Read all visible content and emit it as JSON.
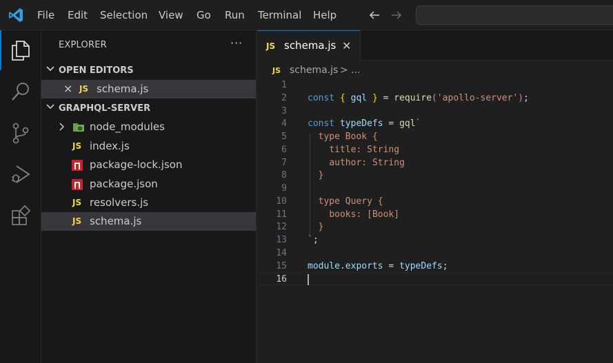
{
  "menu": {
    "items": [
      "File",
      "Edit",
      "Selection",
      "View",
      "Go",
      "Run",
      "Terminal",
      "Help"
    ],
    "back_icon": "arrow-left-icon",
    "forward_icon": "arrow-right-icon"
  },
  "activity_bar": {
    "items": [
      "explorer-icon",
      "search-icon",
      "source-control-icon",
      "run-debug-icon",
      "extensions-icon"
    ],
    "active": "explorer-icon"
  },
  "sidebar": {
    "title": "EXPLORER",
    "more": "···",
    "open_editors": {
      "header": "OPEN EDITORS",
      "items": [
        {
          "close": "×",
          "icon": "JS",
          "label": "schema.js"
        }
      ]
    },
    "project": {
      "header": "GRAPHQL-SERVER",
      "items": [
        {
          "type": "folder",
          "label": "node_modules"
        },
        {
          "type": "js",
          "icon": "JS",
          "label": "index.js"
        },
        {
          "type": "npm",
          "label": "package-lock.json"
        },
        {
          "type": "npm",
          "label": "package.json"
        },
        {
          "type": "js",
          "icon": "JS",
          "label": "resolvers.js"
        },
        {
          "type": "js",
          "icon": "JS",
          "label": "schema.js",
          "selected": true
        }
      ]
    }
  },
  "editor": {
    "tab": {
      "icon": "JS",
      "label": "schema.js",
      "close": "✕"
    },
    "breadcrumb": {
      "icon": "JS",
      "file": "schema.js",
      "sep": ">",
      "more": "..."
    },
    "active_line": 16,
    "lines": [
      "",
      "const { gql } = require('apollo-server');",
      "",
      "const typeDefs = gql`",
      "  type Book {",
      "    title: String",
      "    author: String",
      "  }",
      "",
      "  type Query {",
      "    books: [Book]",
      "  }",
      "`;",
      "",
      "module.exports = typeDefs;",
      ""
    ]
  },
  "colors": {
    "accent": "#0078d4",
    "js_icon": "#f1d84b",
    "npm_icon": "#c8232c",
    "keyword": "#569cd6",
    "string": "#ce9178",
    "function": "#dcdcaa",
    "variable": "#9cdcfe"
  }
}
